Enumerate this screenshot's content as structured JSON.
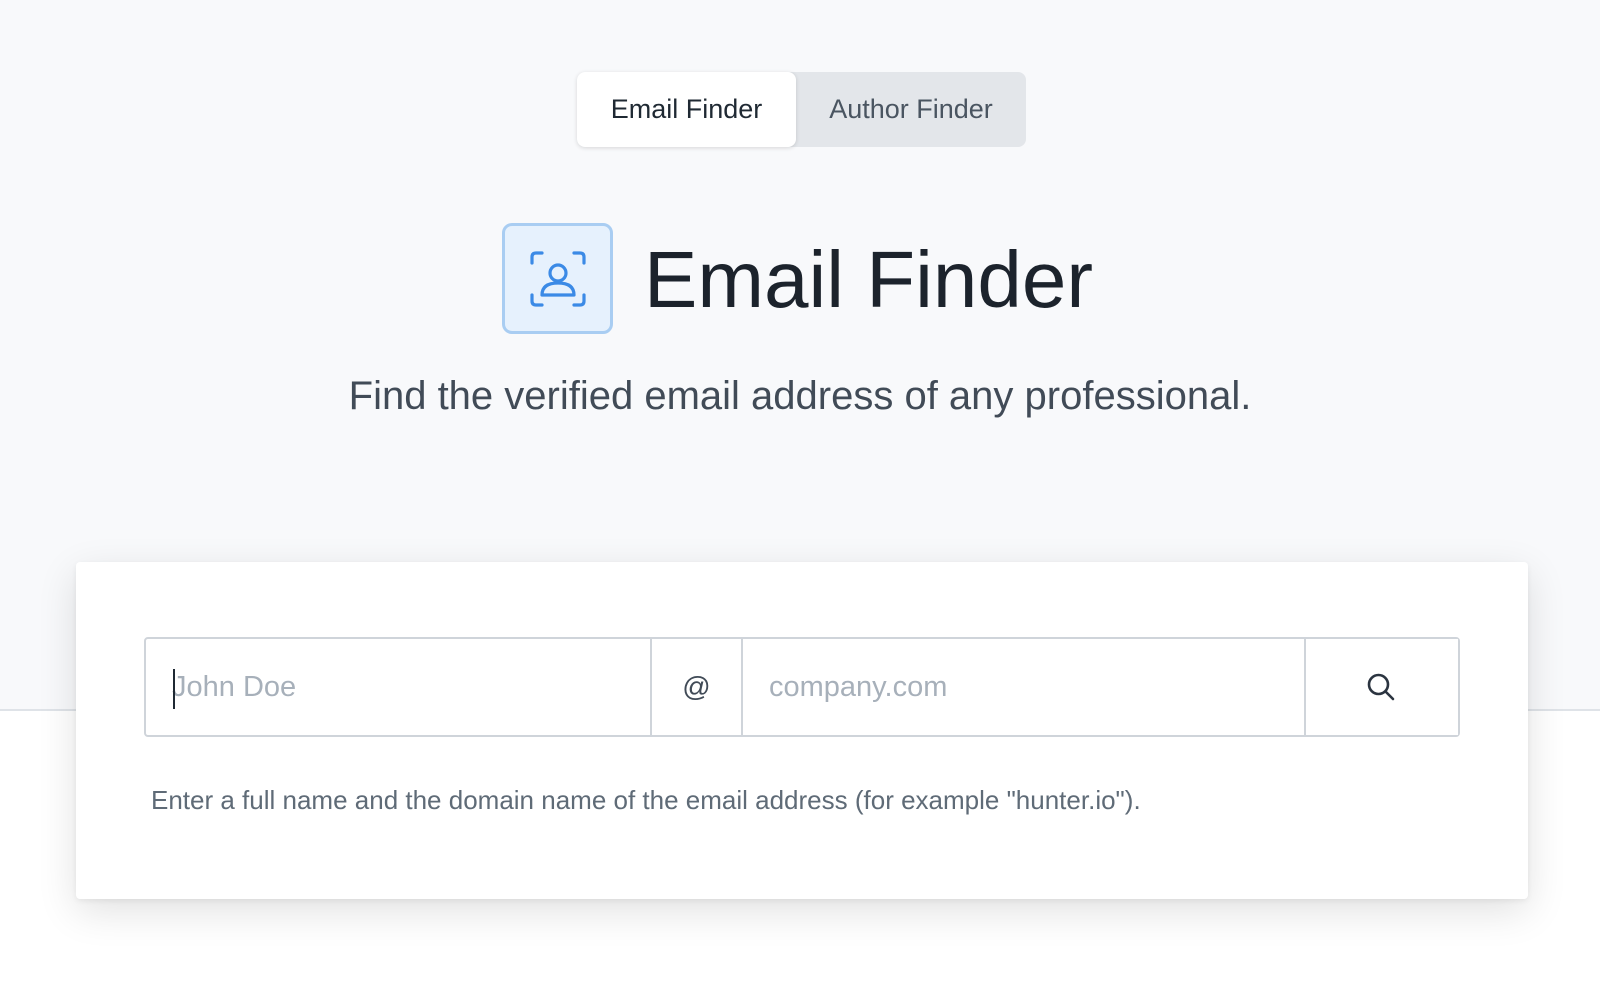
{
  "tabs": [
    {
      "label": "Email Finder",
      "active": true
    },
    {
      "label": "Author Finder",
      "active": false
    }
  ],
  "header": {
    "icon": "user-focus-icon",
    "title": "Email Finder",
    "subtitle": "Find the verified email address of any professional."
  },
  "form": {
    "name_placeholder": "John Doe",
    "name_value": "",
    "at_symbol": "@",
    "domain_placeholder": "company.com",
    "domain_value": "",
    "search_icon": "search-icon",
    "helper_text": "Enter a full name and the domain name of the email address (for example \"hunter.io\")."
  },
  "colors": {
    "accent": "#3b8ae6",
    "icon_bg": "#e6f1fd",
    "title": "#1c232c",
    "page_bg": "#f8f9fb"
  }
}
